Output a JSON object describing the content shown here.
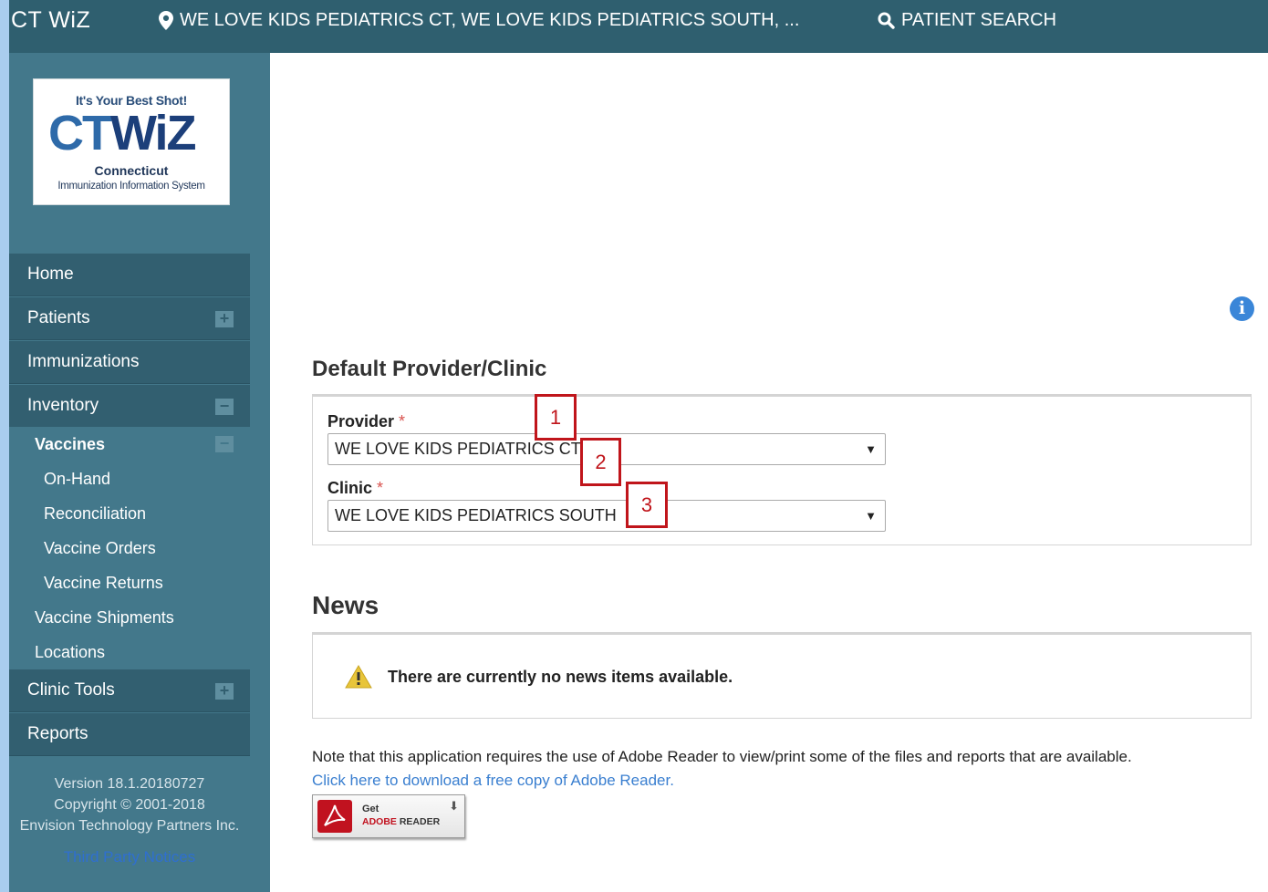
{
  "topbar": {
    "brand": "CT WiZ",
    "location": "WE LOVE KIDS PEDIATRICS CT, WE LOVE KIDS PEDIATRICS SOUTH, ...",
    "patient_search": "PATIENT SEARCH"
  },
  "logo": {
    "tagline": "It's Your Best Shot!",
    "mark_left": "CT",
    "mark_right": "WiZ",
    "state": "Connecticut",
    "system": "Immunization Information System"
  },
  "nav": {
    "home": "Home",
    "patients": "Patients",
    "immunizations": "Immunizations",
    "inventory": "Inventory",
    "vaccines": "Vaccines",
    "on_hand": "On-Hand",
    "reconciliation": "Reconciliation",
    "vaccine_orders": "Vaccine Orders",
    "vaccine_returns": "Vaccine Returns",
    "vaccine_shipments": "Vaccine Shipments",
    "locations": "Locations",
    "clinic_tools": "Clinic Tools",
    "reports": "Reports",
    "expand_symbol": "+",
    "collapse_symbol": "−"
  },
  "footer": {
    "version": "Version 18.1.20180727",
    "copyright": "Copyright © 2001-2018",
    "company": "Envision Technology Partners Inc.",
    "third_party": "Third Party Notices"
  },
  "default_provider": {
    "title": "Default Provider/Clinic",
    "provider_label": "Provider",
    "provider_value": "WE LOVE KIDS PEDIATRICS CT",
    "clinic_label": "Clinic",
    "clinic_value": "WE LOVE KIDS PEDIATRICS SOUTH",
    "required_mark": "*",
    "dropdown_arrow": "▼"
  },
  "callouts": [
    "1",
    "2",
    "3"
  ],
  "news": {
    "title": "News",
    "message": "There are currently no news items available."
  },
  "adobe": {
    "note": "Note that this application requires the use of Adobe Reader to view/print some of the files and reports that are available.",
    "link": "Click here to download a free copy of Adobe Reader.",
    "badge_get": "Get",
    "badge_adobe": "ADOBE",
    "badge_reader": "READER"
  },
  "info_icon": "i",
  "colors": {
    "topbar": "#2f5f6f",
    "sidebar": "#43788b",
    "nav_item": "#325f70",
    "callout": "#c0151b",
    "link": "#3a7fd0"
  }
}
